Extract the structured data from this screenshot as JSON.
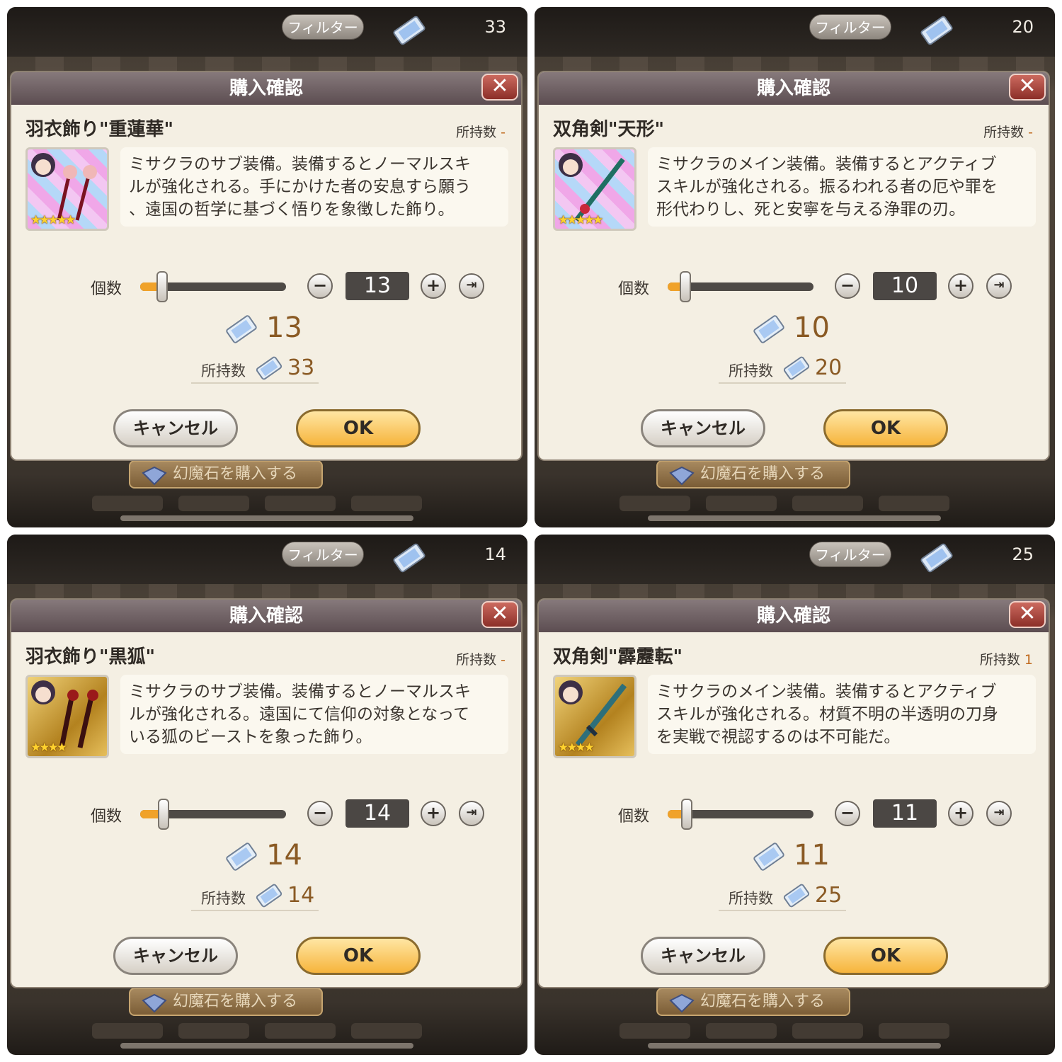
{
  "colors": {
    "dialog_bg": "#f4efe3",
    "header": "#6e6064",
    "ok_button": "#f6b43c",
    "slider_fill": "#f0a22a",
    "value_text": "#8a5a24"
  },
  "panels": [
    {
      "top": {
        "filter_label": "フィルター",
        "stone_count": "33"
      },
      "dialog": {
        "title": "購入確認",
        "close_icon": "✕",
        "item_name": "羽衣飾り\"重蓮華\"",
        "owned_label": "所持数",
        "owned_value": "-",
        "icon_style": "pastel",
        "stars": "★★★★★",
        "description": "ミサクラのサブ装備。装備するとノーマルスキ\nルが強化される。手にかけた者の安息すら願う\n、遠国の哲学に基づく悟りを象徴した飾り。",
        "quantity_label": "個数",
        "quantity": "13",
        "slider_fraction": 0.15,
        "minus": "−",
        "plus": "+",
        "max": "⇥",
        "cost": "13",
        "have_label": "所持数",
        "have_value": "33",
        "cancel_label": "キャンセル",
        "ok_label": "OK"
      },
      "buy_stone_label": "幻魔石を購入する"
    },
    {
      "top": {
        "filter_label": "フィルター",
        "stone_count": "20"
      },
      "dialog": {
        "title": "購入確認",
        "close_icon": "✕",
        "item_name": "双角剣\"天形\"",
        "owned_label": "所持数",
        "owned_value": "-",
        "icon_style": "pastel",
        "stars": "★★★★★",
        "description": "ミサクラのメイン装備。装備するとアクティブ\nスキルが強化される。振るわれる者の厄や罪を\n形代わりし、死と安寧を与える浄罪の刃。",
        "quantity_label": "個数",
        "quantity": "10",
        "slider_fraction": 0.12,
        "minus": "−",
        "plus": "+",
        "max": "⇥",
        "cost": "10",
        "have_label": "所持数",
        "have_value": "20",
        "cancel_label": "キャンセル",
        "ok_label": "OK"
      },
      "buy_stone_label": "幻魔石を購入する"
    },
    {
      "top": {
        "filter_label": "フィルター",
        "stone_count": "14"
      },
      "dialog": {
        "title": "購入確認",
        "close_icon": "✕",
        "item_name": "羽衣飾り\"黒狐\"",
        "owned_label": "所持数",
        "owned_value": "-",
        "icon_style": "gold",
        "stars": "★★★★",
        "description": "ミサクラのサブ装備。装備するとノーマルスキ\nルが強化される。遠国にて信仰の対象となって\nいる狐のビーストを象った飾り。",
        "quantity_label": "個数",
        "quantity": "14",
        "slider_fraction": 0.16,
        "minus": "−",
        "plus": "+",
        "max": "⇥",
        "cost": "14",
        "have_label": "所持数",
        "have_value": "14",
        "cancel_label": "キャンセル",
        "ok_label": "OK"
      },
      "buy_stone_label": "幻魔石を購入する"
    },
    {
      "top": {
        "filter_label": "フィルター",
        "stone_count": "25"
      },
      "dialog": {
        "title": "購入確認",
        "close_icon": "✕",
        "item_name": "双角剣\"霹靂転\"",
        "owned_label": "所持数",
        "owned_value": "1",
        "icon_style": "gold",
        "stars": "★★★★",
        "description": "ミサクラのメイン装備。装備するとアクティブ\nスキルが強化される。材質不明の半透明の刀身\nを実戦で視認するのは不可能だ。",
        "quantity_label": "個数",
        "quantity": "11",
        "slider_fraction": 0.13,
        "minus": "−",
        "plus": "+",
        "max": "⇥",
        "cost": "11",
        "have_label": "所持数",
        "have_value": "25",
        "cancel_label": "キャンセル",
        "ok_label": "OK"
      },
      "buy_stone_label": "幻魔石を購入する"
    }
  ]
}
